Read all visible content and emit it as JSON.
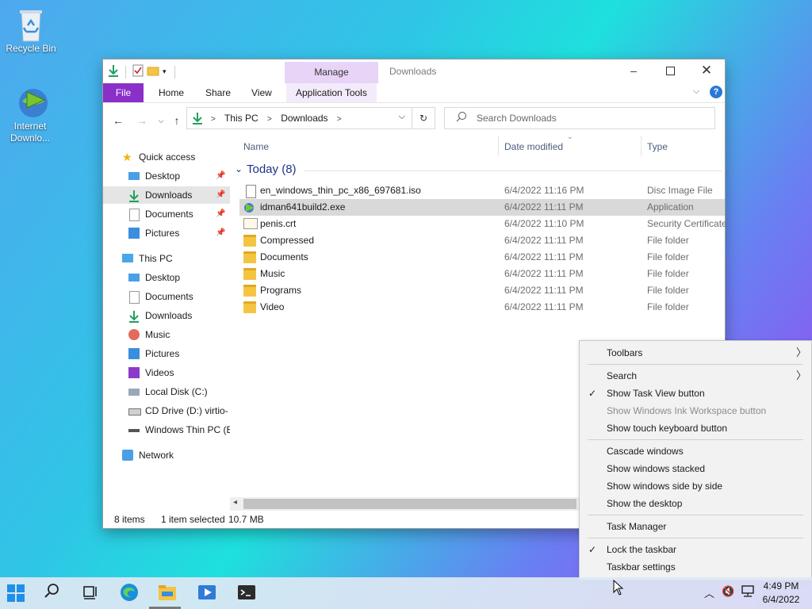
{
  "desktop": {
    "icons": [
      {
        "label": "Recycle Bin"
      },
      {
        "label": "Internet Downlo..."
      }
    ]
  },
  "window": {
    "title": "Downloads",
    "context_tab": "Manage",
    "tabs": [
      "File",
      "Home",
      "Share",
      "View",
      "Application Tools"
    ],
    "address": {
      "crumbs": [
        "This PC",
        "Downloads"
      ]
    },
    "search_placeholder": "Search Downloads",
    "nav": {
      "quick_access": "Quick access",
      "quick_items": [
        "Desktop",
        "Downloads",
        "Documents",
        "Pictures"
      ],
      "this_pc": "This PC",
      "pc_items": [
        "Desktop",
        "Documents",
        "Downloads",
        "Music",
        "Pictures",
        "Videos",
        "Local Disk (C:)",
        "CD Drive (D:) virtio-",
        "Windows Thin PC (E"
      ],
      "network": "Network"
    },
    "columns": {
      "name": "Name",
      "date": "Date modified",
      "type": "Type"
    },
    "group": "Today (8)",
    "files": [
      {
        "name": "en_windows_thin_pc_x86_697681.iso",
        "date": "6/4/2022 11:16 PM",
        "type": "Disc Image File",
        "icon": "disc-image-icon"
      },
      {
        "name": "idman641build2.exe",
        "date": "6/4/2022 11:11 PM",
        "type": "Application",
        "icon": "application-icon"
      },
      {
        "name": "penis.crt",
        "date": "6/4/2022 11:10 PM",
        "type": "Security Certificate",
        "icon": "certificate-icon"
      },
      {
        "name": "Compressed",
        "date": "6/4/2022 11:11 PM",
        "type": "File folder",
        "icon": "folder-icon"
      },
      {
        "name": "Documents",
        "date": "6/4/2022 11:11 PM",
        "type": "File folder",
        "icon": "folder-icon"
      },
      {
        "name": "Music",
        "date": "6/4/2022 11:11 PM",
        "type": "File folder",
        "icon": "folder-icon"
      },
      {
        "name": "Programs",
        "date": "6/4/2022 11:11 PM",
        "type": "File folder",
        "icon": "folder-icon"
      },
      {
        "name": "Video",
        "date": "6/4/2022 11:11 PM",
        "type": "File folder",
        "icon": "folder-icon"
      }
    ],
    "status": {
      "count": "8 items",
      "selected": "1 item selected",
      "size": "10.7 MB"
    }
  },
  "context_menu": {
    "items": [
      {
        "label": "Toolbars"
      },
      {
        "label": "Search"
      },
      {
        "label": "Show Task View button"
      },
      {
        "label": "Show Windows Ink Workspace button"
      },
      {
        "label": "Show touch keyboard button"
      },
      {
        "label": "Cascade windows"
      },
      {
        "label": "Show windows stacked"
      },
      {
        "label": "Show windows side by side"
      },
      {
        "label": "Show the desktop"
      },
      {
        "label": "Task Manager"
      },
      {
        "label": "Lock the taskbar"
      },
      {
        "label": "Taskbar settings"
      }
    ]
  },
  "taskbar": {
    "time": "4:49 PM",
    "date": "6/4/2022"
  },
  "colors": {
    "accent": "#8b2fc9",
    "context_tab": "#e8d4f7",
    "group_text": "#1e3287"
  }
}
